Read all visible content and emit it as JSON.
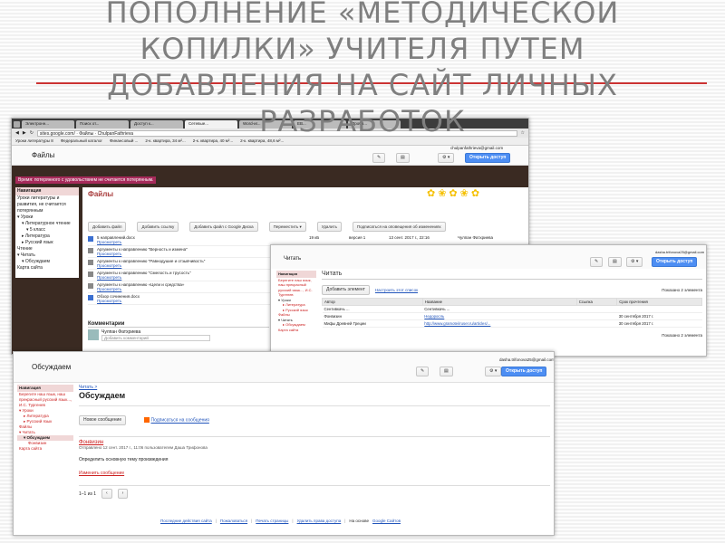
{
  "slide": {
    "title": "ПОПОЛНЕНИЕ «МЕТОДИЧЕСКОЙ КОПИЛКИ» УЧИТЕЛЯ ПУТЕМ ДОБАВЛЕНИЯ НА САЙТ ЛИЧНЫХ РАЗРАБОТОК"
  },
  "browser": {
    "tabs": [
      "Электронн...",
      "Поиск от...",
      "Доступ к...",
      "Сетевые...",
      "Word-иг...",
      "ЕВ...",
      "Пробл..."
    ],
    "url": "sites.google.com/ · Файлы · ChulpanFathrieva",
    "bookmarks": [
      "Уроки литературы 8",
      "Федеральный каталог",
      "Финансовый ...",
      "2-к. квартира, 34 м²...",
      "2-к. квартира, 40 м²...",
      "2-к. квартира, 48,6 м²..."
    ]
  },
  "files_shot": {
    "page_title": "Файлы",
    "user": "chulpanfathrieva@gmail.com",
    "banner": "Время: потерянного с удовольствием не считается потерянным.",
    "heading": "Файлы",
    "toolbar": [
      "Добавить файл",
      "Добавить ссылку",
      "Добавить файл с Google Диска",
      "Переместить ▾",
      "Удалить",
      "Подписаться на оповещения об изменениях"
    ],
    "nav": {
      "header": "Навигация",
      "items": [
        {
          "text": "Уроки литературы и развития, не считается потерянным",
          "level": 0
        },
        {
          "text": "▾ Уроки",
          "level": 0
        },
        {
          "text": "▾ Литературное чтение",
          "level": 1
        },
        {
          "text": "▾ 5 класс",
          "level": 2
        },
        {
          "text": "▸ Литература",
          "level": 1
        },
        {
          "text": "▸ Русский язык",
          "level": 1
        },
        {
          "text": "Чтение",
          "level": 0
        },
        {
          "text": "▾ Читать",
          "level": 0
        },
        {
          "text": "▾ Обсуждаем",
          "level": 1
        },
        {
          "text": "Карта сайта",
          "level": 0
        }
      ]
    },
    "files": [
      {
        "name": "5 направлений.docx",
        "action": "Просмотреть",
        "size": "19 кБ",
        "version": "версия 1",
        "date": "13 сент. 2017 г., 22:16",
        "author": "Чулпан Фатхриева"
      },
      {
        "name": "Аргументы к направлению \"Верность и измена\"",
        "action": "Просмотреть",
        "size": "",
        "version": "",
        "date": "13 сент. 2017 г., 22:26",
        "author": "Чулпан Фатхриева"
      },
      {
        "name": "Аргументы к направлению \"Равнодушие и отзывчивость\"",
        "action": "Просмотреть",
        "size": "",
        "version": "",
        "date": "",
        "author": ""
      },
      {
        "name": "Аргументы к направлению \"Смелость и трусость\"",
        "action": "Просмотреть",
        "size": "",
        "version": "",
        "date": "",
        "author": ""
      },
      {
        "name": "Аргументы к направлению «Цели и средства»",
        "action": "Просмотреть",
        "size": "",
        "version": "",
        "date": "",
        "author": ""
      },
      {
        "name": "Обзор сочинения.docx",
        "action": "Просмотреть",
        "size": "",
        "version": "",
        "date": "",
        "author": ""
      }
    ],
    "comments": {
      "title": "Комментарии",
      "author": "Чулпан Фатхриева",
      "placeholder": "Добавить комментарий"
    }
  },
  "read_shot": {
    "page_title": "Читать",
    "user": "dasha.trifonova25@gmail.com",
    "share": "Открыть доступ",
    "heading": "Читать",
    "add_button": "Добавить элемент",
    "customize": "Настроить этот список",
    "shown": "Показано 2 элемента",
    "shown_bottom": "Показано 2 элемента",
    "nav": {
      "header": "Навигация",
      "items": [
        {
          "text": "Берегите наш язык, наш прекрасный русский язык..., И.С. Тургенев",
          "level": 0,
          "link": true
        },
        {
          "text": "▾ Уроки",
          "level": 0
        },
        {
          "text": "▸ Литература",
          "level": 1,
          "link": true
        },
        {
          "text": "▸ Русский язык",
          "level": 1,
          "link": true
        },
        {
          "text": "Файлы",
          "level": 0,
          "link": true
        },
        {
          "text": "▾ Читать",
          "level": 0
        },
        {
          "text": "▸ Обсуждаем",
          "level": 1,
          "link": true
        },
        {
          "text": "Карта сайта",
          "level": 0,
          "link": true
        }
      ]
    },
    "columns": [
      "Автор",
      "Название",
      "Ссылка",
      "Срок прочтения"
    ],
    "rows": [
      [
        "Сентивкачь ...",
        "Сентивкачь ...",
        "",
        ""
      ],
      [
        "Фонвизин",
        "Недоросль",
        "",
        "30 сентября 2017 г."
      ],
      [
        "Мифы Древней Греции",
        "http://www.gramotei/ruser.ru/articles/...",
        "",
        "30 сентября 2017 г."
      ]
    ]
  },
  "discuss_shot": {
    "page_title": "Обсуждаем",
    "user": "dasha.trifonova25@gmail.com",
    "share": "Открыть доступ",
    "breadcrumb": "Читать >",
    "heading": "Обсуждаем",
    "new_message": "Новое сообщение",
    "subscribe": "Подписаться на сообщения",
    "nav": {
      "header": "Навигация",
      "items": [
        {
          "text": "Берегите наш язык, наш прекрасный русский язык..., И.С. Тургенев",
          "level": 0,
          "link": true
        },
        {
          "text": "▾ Уроки",
          "level": 0,
          "link": true
        },
        {
          "text": "▸ Литература",
          "level": 1,
          "link": true
        },
        {
          "text": "▸ Русский язык",
          "level": 1,
          "link": true
        },
        {
          "text": "Файлы",
          "level": 0,
          "link": true
        },
        {
          "text": "▾ Читать",
          "level": 0,
          "link": true
        },
        {
          "text": "▾ Обсуждаем",
          "level": 1,
          "selected": true
        },
        {
          "text": "Фонвизин",
          "level": 2,
          "link": true
        },
        {
          "text": "Карта сайта",
          "level": 0,
          "link": true
        }
      ]
    },
    "post": {
      "title": "Фонвизин",
      "meta": "Отправлено 12 сент. 2017 г., 11:06 пользователем Даша Трифонова",
      "body": "Определить основную тему произведения",
      "reply": "Изменить сообщение"
    },
    "pagination": "1–1 из 1",
    "footer": [
      "Последние действия сайта",
      "Пожаловаться",
      "Печать страницы",
      "Удалить права доступа",
      "На основе",
      "Google Сайтов"
    ]
  },
  "colors": {
    "accent_rule": "#cc3333",
    "title_gray": "#7f7f7f",
    "nav_pink": "#f0d7d7",
    "link_red": "#cc2222",
    "share_blue": "#4d8ef3"
  }
}
